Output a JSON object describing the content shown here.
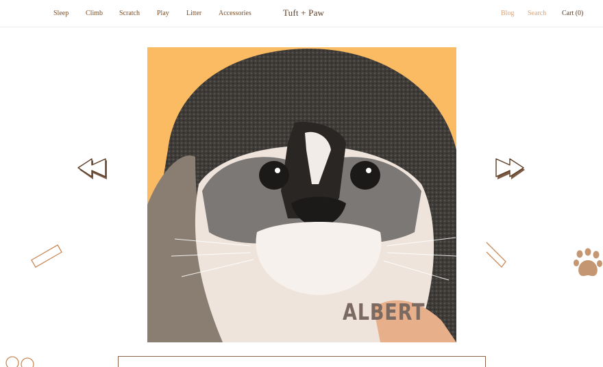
{
  "header": {
    "nav": [
      {
        "label": "Sleep"
      },
      {
        "label": "Climb"
      },
      {
        "label": "Scratch"
      },
      {
        "label": "Play"
      },
      {
        "label": "Litter"
      },
      {
        "label": "Accessories"
      }
    ],
    "brand": "Tuft + Paw",
    "utility": {
      "blog": "Blog",
      "search": "Search",
      "cart": "Cart (0)"
    }
  },
  "hero": {
    "cat_name": "ALBERT",
    "background_color": "#fbbb63",
    "prev_icon": "rewind-icon",
    "next_icon": "fast-forward-icon"
  },
  "colors": {
    "brand_brown": "#7a4a22",
    "muted_peach": "#d8a37a",
    "accent_orange": "#fbbb63",
    "outline_brown": "#8a6248"
  }
}
